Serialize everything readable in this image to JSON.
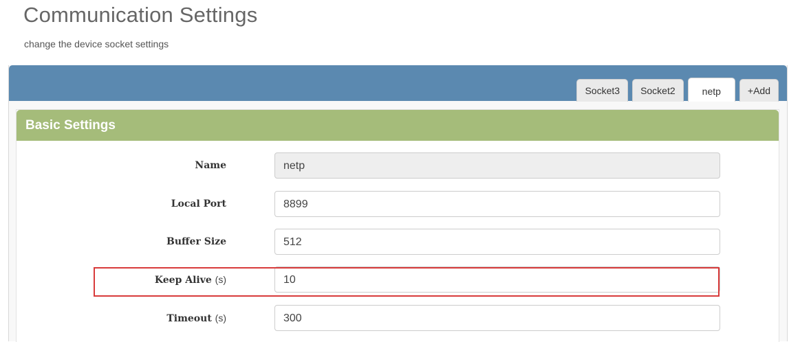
{
  "page": {
    "title": "Communication Settings",
    "subtitle": "change the device socket settings"
  },
  "tabs": [
    {
      "label": "Socket3",
      "active": false
    },
    {
      "label": "Socket2",
      "active": false
    },
    {
      "label": "netp",
      "active": true
    },
    {
      "label": "+Add",
      "active": false
    }
  ],
  "section": {
    "title": "Basic Settings"
  },
  "fields": {
    "name": {
      "label": "Name",
      "unit": "",
      "value": "netp"
    },
    "local_port": {
      "label": "Local Port",
      "unit": "",
      "value": "8899"
    },
    "buffer_size": {
      "label": "Buffer Size",
      "unit": "",
      "value": "512"
    },
    "keep_alive": {
      "label": "Keep Alive",
      "unit": "(s)",
      "value": "10"
    },
    "timeout": {
      "label": "Timeout",
      "unit": "(s)",
      "value": "300"
    }
  },
  "colors": {
    "header_blue": "#5b89b0",
    "section_green": "#a5bc7a",
    "highlight_red": "#d83a3a"
  }
}
